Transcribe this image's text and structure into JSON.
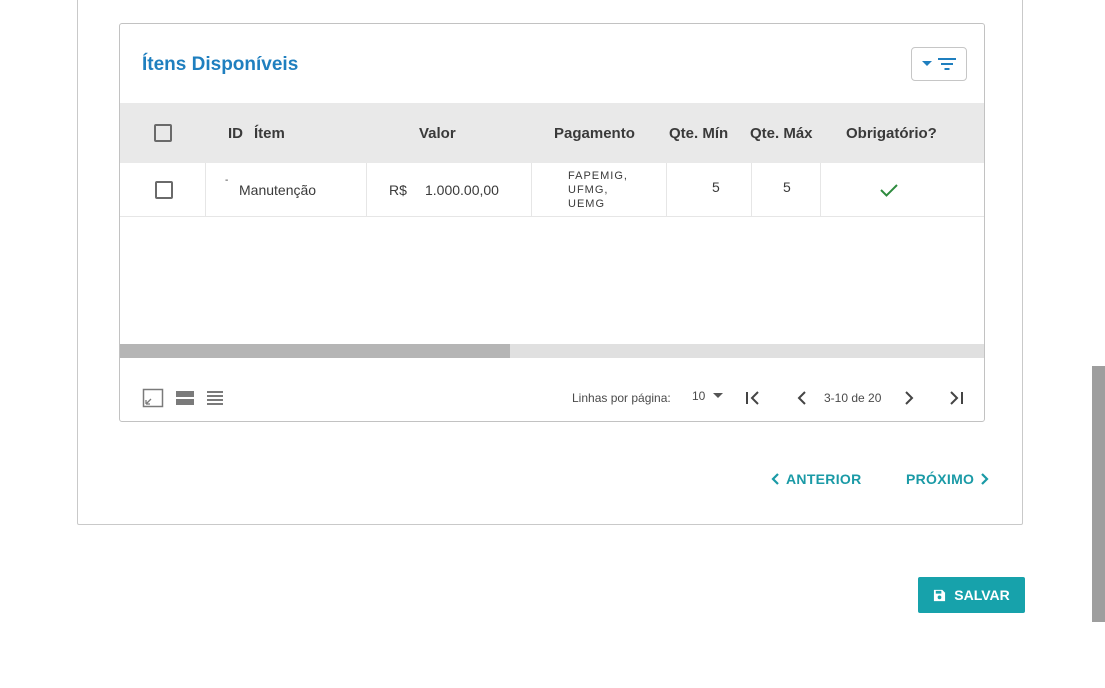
{
  "table": {
    "title": "Ítens Disponíveis",
    "columns": {
      "id": "ID",
      "item": "Ítem",
      "valor": "Valor",
      "pagamento": "Pagamento",
      "qte_min": "Qte. Mín",
      "qte_max": "Qte. Máx",
      "obrigatorio": "Obrigatório?"
    },
    "rows": [
      {
        "id": "-",
        "item": "Manutenção",
        "currency": "R$",
        "valor": "1.000.00,00",
        "pagamento": [
          "FAPEMIG,",
          "UFMG,",
          "UEMG"
        ],
        "qte_min": "5",
        "qte_max": "5",
        "obrigatorio": true
      }
    ],
    "horizontal_scroll_position": 0.45
  },
  "pagination": {
    "rows_per_page_label": "Linhas por página:",
    "rows_per_page_value": "10",
    "range": "3-10 de 20"
  },
  "navigation": {
    "previous_label": "ANTERIOR",
    "next_label": "PRÓXIMO"
  },
  "actions": {
    "save_label": "SALVAR"
  },
  "colors": {
    "title": "#1f7fbf",
    "accent": "#17a2ab",
    "check": "#2e8b3e"
  },
  "icons": [
    "filter-icon",
    "dropdown-arrow-icon",
    "fullscreen-icon",
    "density-icon",
    "list-density-icon",
    "first-page-icon",
    "previous-page-icon",
    "next-page-icon",
    "last-page-icon",
    "chevron-left-icon",
    "chevron-right-icon",
    "save-icon",
    "check-icon"
  ]
}
